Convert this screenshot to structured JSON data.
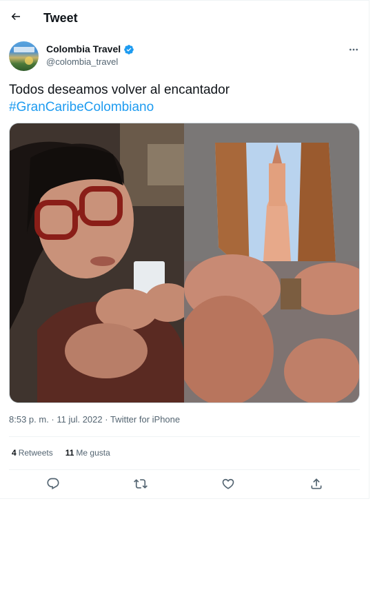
{
  "header": {
    "title": "Tweet",
    "back_icon": "arrow-left-icon"
  },
  "tweet": {
    "author_name": "Colombia Travel",
    "author_handle": "@colombia_travel",
    "verified_icon": "verified-badge-icon",
    "text": "Todos deseamos volver al encantador",
    "hashtag": "#GranCaribeColombiano",
    "timestamp": "8:53 p. m. · 11 jul. 2022",
    "source": "Twitter for iPhone",
    "source_separator": " · ",
    "retweets_count": "4",
    "retweets_label": "Retweets",
    "likes_count": "11",
    "likes_label": "Me gusta"
  },
  "actions": {
    "reply_icon": "reply-icon",
    "retweet_icon": "retweet-icon",
    "like_icon": "heart-icon",
    "share_icon": "share-icon",
    "more_icon": "more-options-icon"
  },
  "colors": {
    "accent": "#1d9bf0",
    "text_primary": "#0f1419",
    "text_secondary": "#536471",
    "border": "#eff3f4"
  }
}
